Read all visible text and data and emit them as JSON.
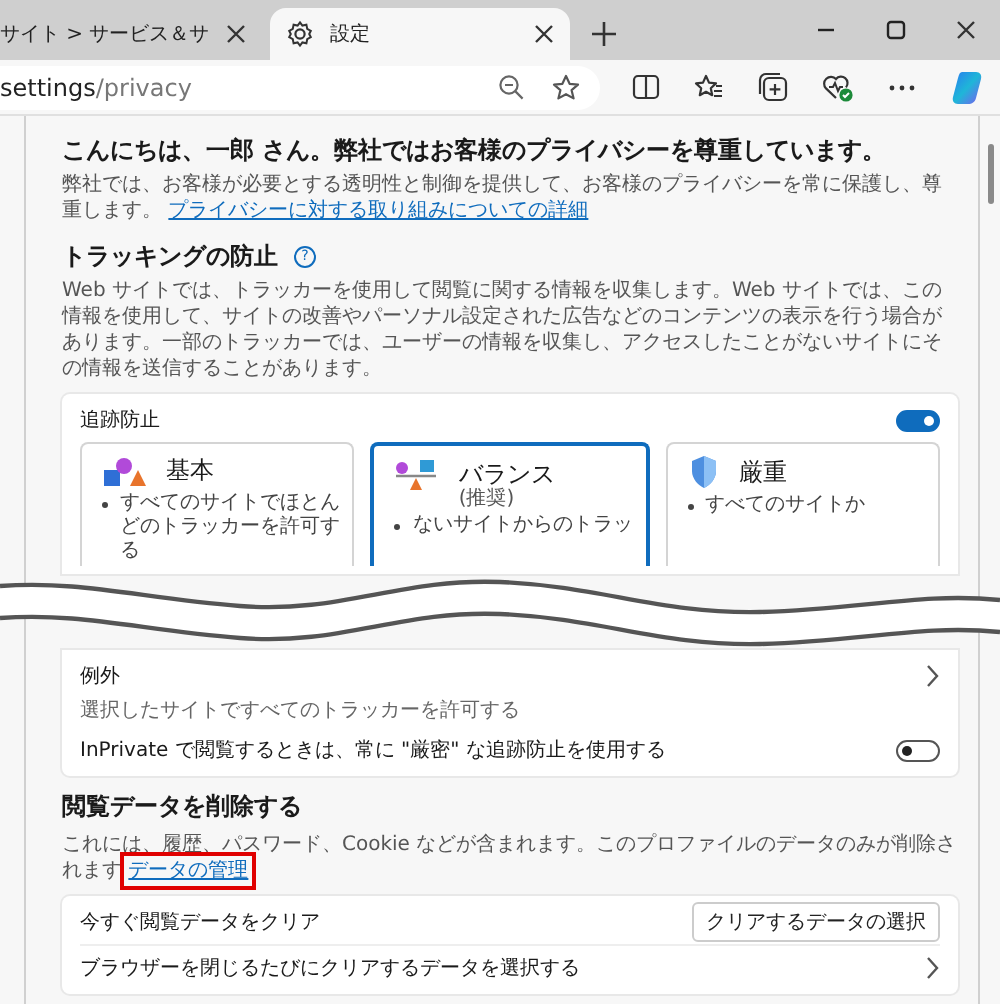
{
  "tabs": [
    {
      "label": "サイト > サービス＆サ",
      "selected": false
    },
    {
      "label": "設定",
      "selected": true
    }
  ],
  "address": {
    "host": "settings",
    "path": "/privacy"
  },
  "greeting": {
    "title": "こんにちは、一郎 さん。弊社ではお客様のプライバシーを尊重しています。",
    "text": "弊社では、お客様が必要とする透明性と制御を提供して、お客様のプライバシーを常に保護し、尊重します。",
    "link": "プライバシーに対する取り組みについての詳細"
  },
  "tracking": {
    "title": "トラッキングの防止",
    "help": "?",
    "description": "Web サイトでは、トラッカーを使用して閲覧に関する情報を収集します。Web サイトでは、この情報を使用して、サイトの改善やパーソナル設定された広告などのコンテンツの表示を行う場合があります。一部のトラッカーでは、ユーザーの情報を収集し、アクセスしたことがないサイトにその情報を送信することがあります。",
    "toggle": {
      "label": "追跡防止",
      "on": true
    },
    "levels": [
      {
        "kind": "basic",
        "title": "基本",
        "bullet": "すべてのサイトでほとんどのトラッカーを許可する",
        "selected": false
      },
      {
        "kind": "balanced",
        "title": "バランス",
        "note": "(推奨)",
        "bullet": "ないサイトからのトラッ",
        "selected": true
      },
      {
        "kind": "strict",
        "title": "厳重",
        "bullet": "すべてのサイトか",
        "selected": false
      }
    ],
    "exceptions": {
      "title": "例外",
      "text": "選択したサイトですべてのトラッカーを許可する"
    },
    "inprivate": {
      "label": "InPrivate で閲覧するときは、常に \"厳密\" な追跡防止を使用する",
      "on": false
    }
  },
  "clear": {
    "title": "閲覧データを削除する",
    "text": "これには、履歴、パスワード、Cookie などが含まれます。このプロファイルのデータのみが削除されます",
    "link": "データの管理",
    "link_highlighted": true,
    "rows": [
      {
        "kind": "button",
        "label": "今すぐ閲覧データをクリア",
        "button": "クリアするデータの選択"
      },
      {
        "kind": "link",
        "label": "ブラウザーを閉じるたびにクリアするデータを選択する"
      }
    ]
  }
}
